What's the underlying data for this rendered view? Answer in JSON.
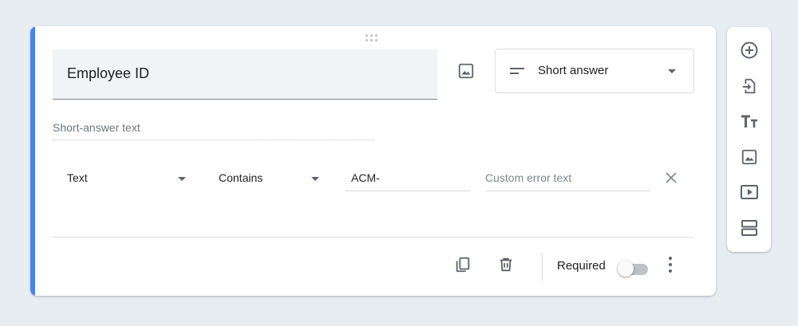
{
  "question": {
    "title": "Employee ID",
    "type_label": "Short answer",
    "answer_placeholder": "Short-answer text"
  },
  "validation": {
    "category": "Text",
    "condition": "Contains",
    "pattern": "ACM-",
    "error_placeholder": "Custom error text"
  },
  "footer": {
    "required_label": "Required",
    "required_on": false
  },
  "toolbar": {
    "tools": [
      "add-question-icon",
      "import-questions-icon",
      "add-title-icon",
      "add-image-icon",
      "add-video-icon",
      "add-section-icon"
    ]
  },
  "colors": {
    "accent": "#4285f4",
    "icon": "#5f6368",
    "background": "#e8edf2"
  }
}
